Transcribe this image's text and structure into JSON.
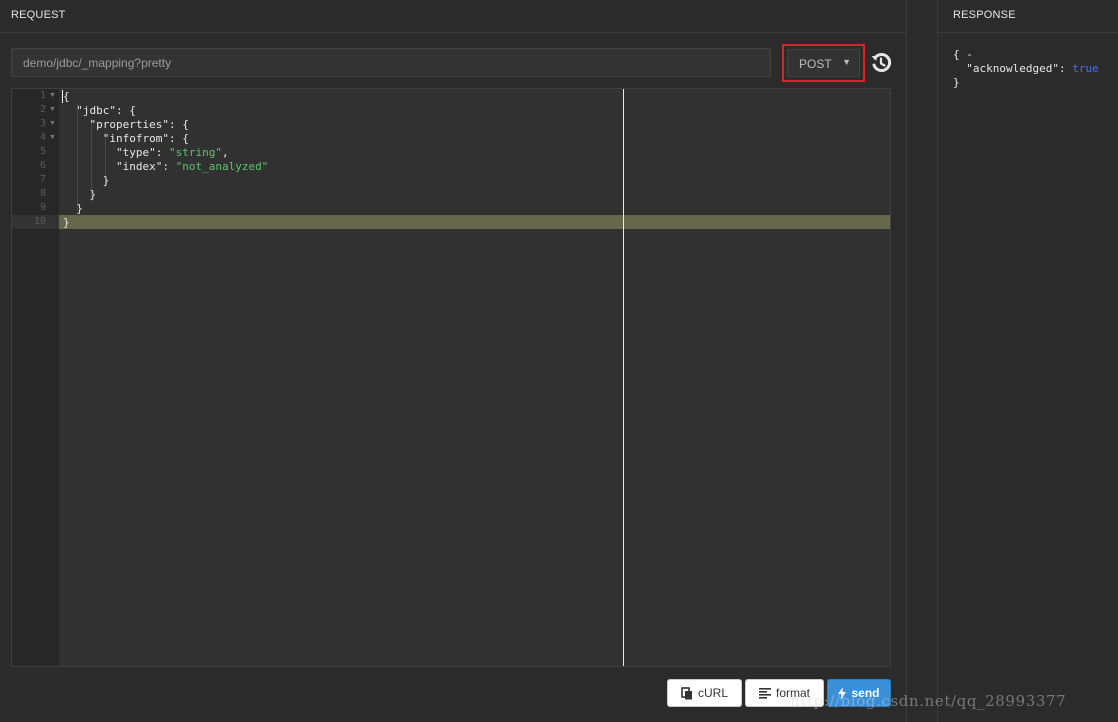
{
  "request": {
    "title": "REQUEST",
    "url_value": "demo/jdbc/_mapping?pretty",
    "method": "POST",
    "editor_lines": [
      {
        "n": "1",
        "t": "{"
      },
      {
        "n": "2",
        "t": "  \"jdbc\": {"
      },
      {
        "n": "3",
        "t": "    \"properties\": {"
      },
      {
        "n": "4",
        "t": "      \"infofrom\": {"
      },
      {
        "n": "5",
        "t": "        \"type\": \"string\","
      },
      {
        "n": "6",
        "t": "        \"index\": \"not_analyzed\""
      },
      {
        "n": "7",
        "t": "      }"
      },
      {
        "n": "8",
        "t": "    }"
      },
      {
        "n": "9",
        "t": "  }"
      },
      {
        "n": "10",
        "t": "}"
      }
    ]
  },
  "buttons": {
    "curl": "cURL",
    "format": "format",
    "send": "send"
  },
  "response": {
    "title": "RESPONSE",
    "line1": "{ -",
    "key": "\"acknowledged\"",
    "colon": ": ",
    "value": "true",
    "line3": "}"
  },
  "watermark": "http://blog.csdn.net/qq_28993377",
  "icons": {
    "history": "history-icon",
    "method_caret": "caret-down-icon",
    "curl": "clipboard-icon",
    "format": "align-left-icon",
    "send": "bolt-icon"
  },
  "colors": {
    "accent": "#3a8fd9",
    "highlight": "#65684a",
    "method_outline": "#d8232a",
    "string": "#5ec46a",
    "keyword": "#4e6bff"
  }
}
